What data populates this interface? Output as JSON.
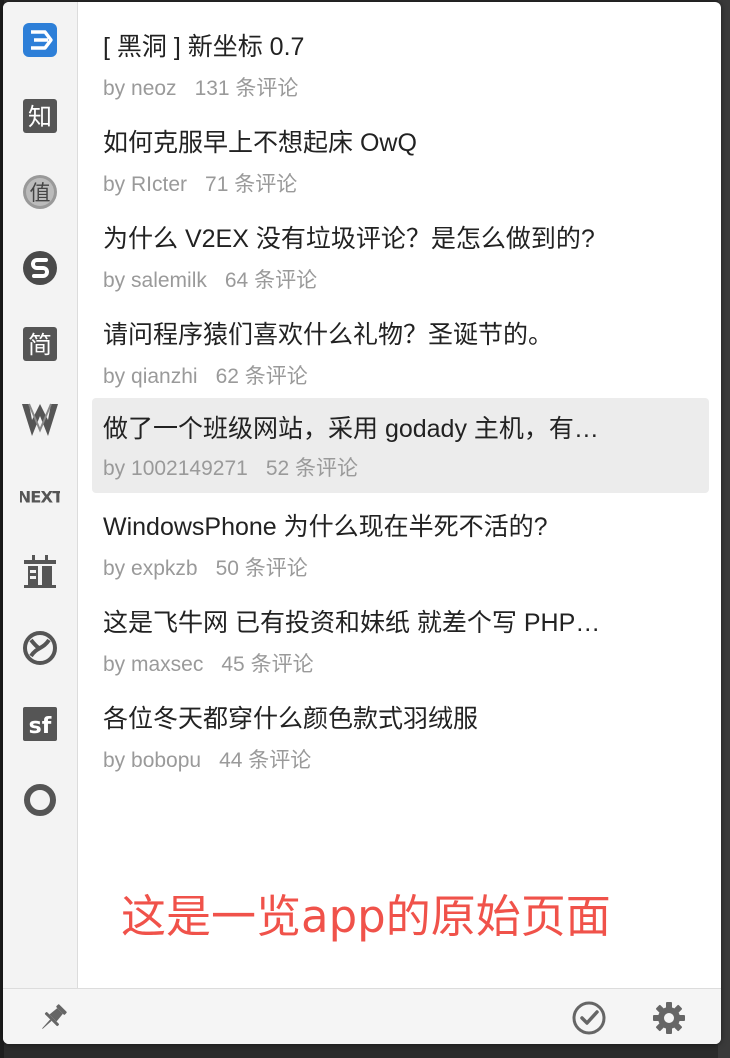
{
  "sidebar": {
    "items": [
      {
        "name": "v2ex-icon",
        "label": "V2EX",
        "color": "#2d7fd8"
      },
      {
        "name": "zhihu-icon",
        "label": "知"
      },
      {
        "name": "smzdm-icon",
        "label": "值"
      },
      {
        "name": "segment-s-icon",
        "label": "S"
      },
      {
        "name": "jianshu-icon",
        "label": "简"
      },
      {
        "name": "w-logo-icon",
        "label": "W"
      },
      {
        "name": "next-icon",
        "label": "NEXT"
      },
      {
        "name": "qianduan-icon",
        "label": "前"
      },
      {
        "name": "knot-icon",
        "label": ""
      },
      {
        "name": "segmentfault-icon",
        "label": "sf"
      },
      {
        "name": "ring-icon",
        "label": ""
      }
    ]
  },
  "topics": [
    {
      "title": "[ 黑洞 ] 新坐标 0.7",
      "author": "by neoz",
      "comments": "131 条评论"
    },
    {
      "title": "如何克服早上不想起床 OwQ",
      "author": "by RIcter",
      "comments": "71 条评论"
    },
    {
      "title": "为什么 V2EX 没有垃圾评论？是怎么做到的?",
      "author": "by salemilk",
      "comments": "64 条评论"
    },
    {
      "title": "请问程序猿们喜欢什么礼物？圣诞节的。",
      "author": "by qianzhi",
      "comments": "62 条评论"
    },
    {
      "title": "做了一个班级网站，采用 godady 主机，有…",
      "author": "by 1002149271",
      "comments": "52 条评论"
    },
    {
      "title": "WindowsPhone 为什么现在半死不活的?",
      "author": "by expkzb",
      "comments": "50 条评论"
    },
    {
      "title": "这是飞牛网 已有投资和妹纸 就差个写 PHP…",
      "author": "by maxsec",
      "comments": "45 条评论"
    },
    {
      "title": "各位冬天都穿什么颜色款式羽绒服",
      "author": "by bobopu",
      "comments": "44 条评论"
    }
  ],
  "selected_index": 4,
  "note": "这是一览app的原始页面",
  "footer": {
    "pin": "pin-icon",
    "check": "check-circle-icon",
    "settings": "gear-icon"
  }
}
